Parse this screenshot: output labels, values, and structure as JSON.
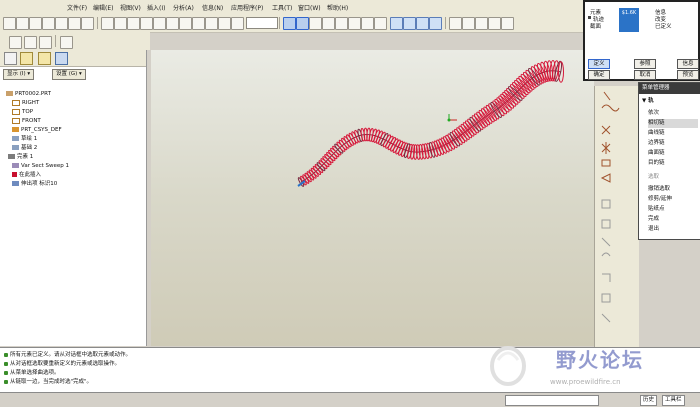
{
  "menubar": {
    "items": [
      "文件(F)",
      "编辑(E)",
      "视图(V)",
      "插入(I)",
      "分析(A)",
      "信息(N)",
      "应用程序(P)",
      "工具(T)",
      "窗口(W)",
      "帮助(H)"
    ]
  },
  "tree": {
    "display_button": "显示 (I) ▾",
    "settings_button": "设置 (G) ▾",
    "items": [
      "PRT0002.PRT",
      "RIGHT",
      "TOP",
      "FRONT",
      "PRT_CSYS_DEF",
      "草绘 1",
      "基础 2",
      "完素 1",
      "Var Sect Sweep 1",
      "在此插入",
      "伸出项 标识10"
    ]
  },
  "element_dialog": {
    "col_element": "元素",
    "col_info": "信息",
    "row_trajectory": "轨迹",
    "row_section": "截面",
    "info_changed": "改变",
    "info_defined": "已定义",
    "highlight_value": "$1.6K",
    "btn_define": "定义",
    "btn_ref": "参照",
    "btn_info": "信息",
    "btn_ok": "确定",
    "btn_cancel": "取消",
    "btn_preview": "预览"
  },
  "menu_manager": {
    "title": "菜单管理器",
    "section": "▼ 轨",
    "items": [
      "依次",
      "相切链",
      "曲线链",
      "边界链",
      "曲面链",
      "目的链"
    ],
    "section2": "选取",
    "items2": [
      "撤销选取",
      "修剪/延伸",
      "贴纸点",
      "完成",
      "退出"
    ]
  },
  "messages": [
    "所有元素已定义。请从对话框中选取元素或动作。",
    "从对话框选取要重新定义的元素或选取操作。",
    "从菜单选择曲选项。",
    "从链取一边，当完成时选\"完成\"。"
  ],
  "status": {
    "smart_filter": "",
    "filter_label": "历史",
    "tools_label": "工具栏"
  },
  "watermark": {
    "text": "野火论坛",
    "url": "www.proewildfire.cn"
  },
  "colors": {
    "spring": "#d6193b",
    "spring_shadow": "#7a2a40",
    "selection": "#2b73c7",
    "background_top": "#eaebe4",
    "background_bottom": "#cfcbb7"
  }
}
